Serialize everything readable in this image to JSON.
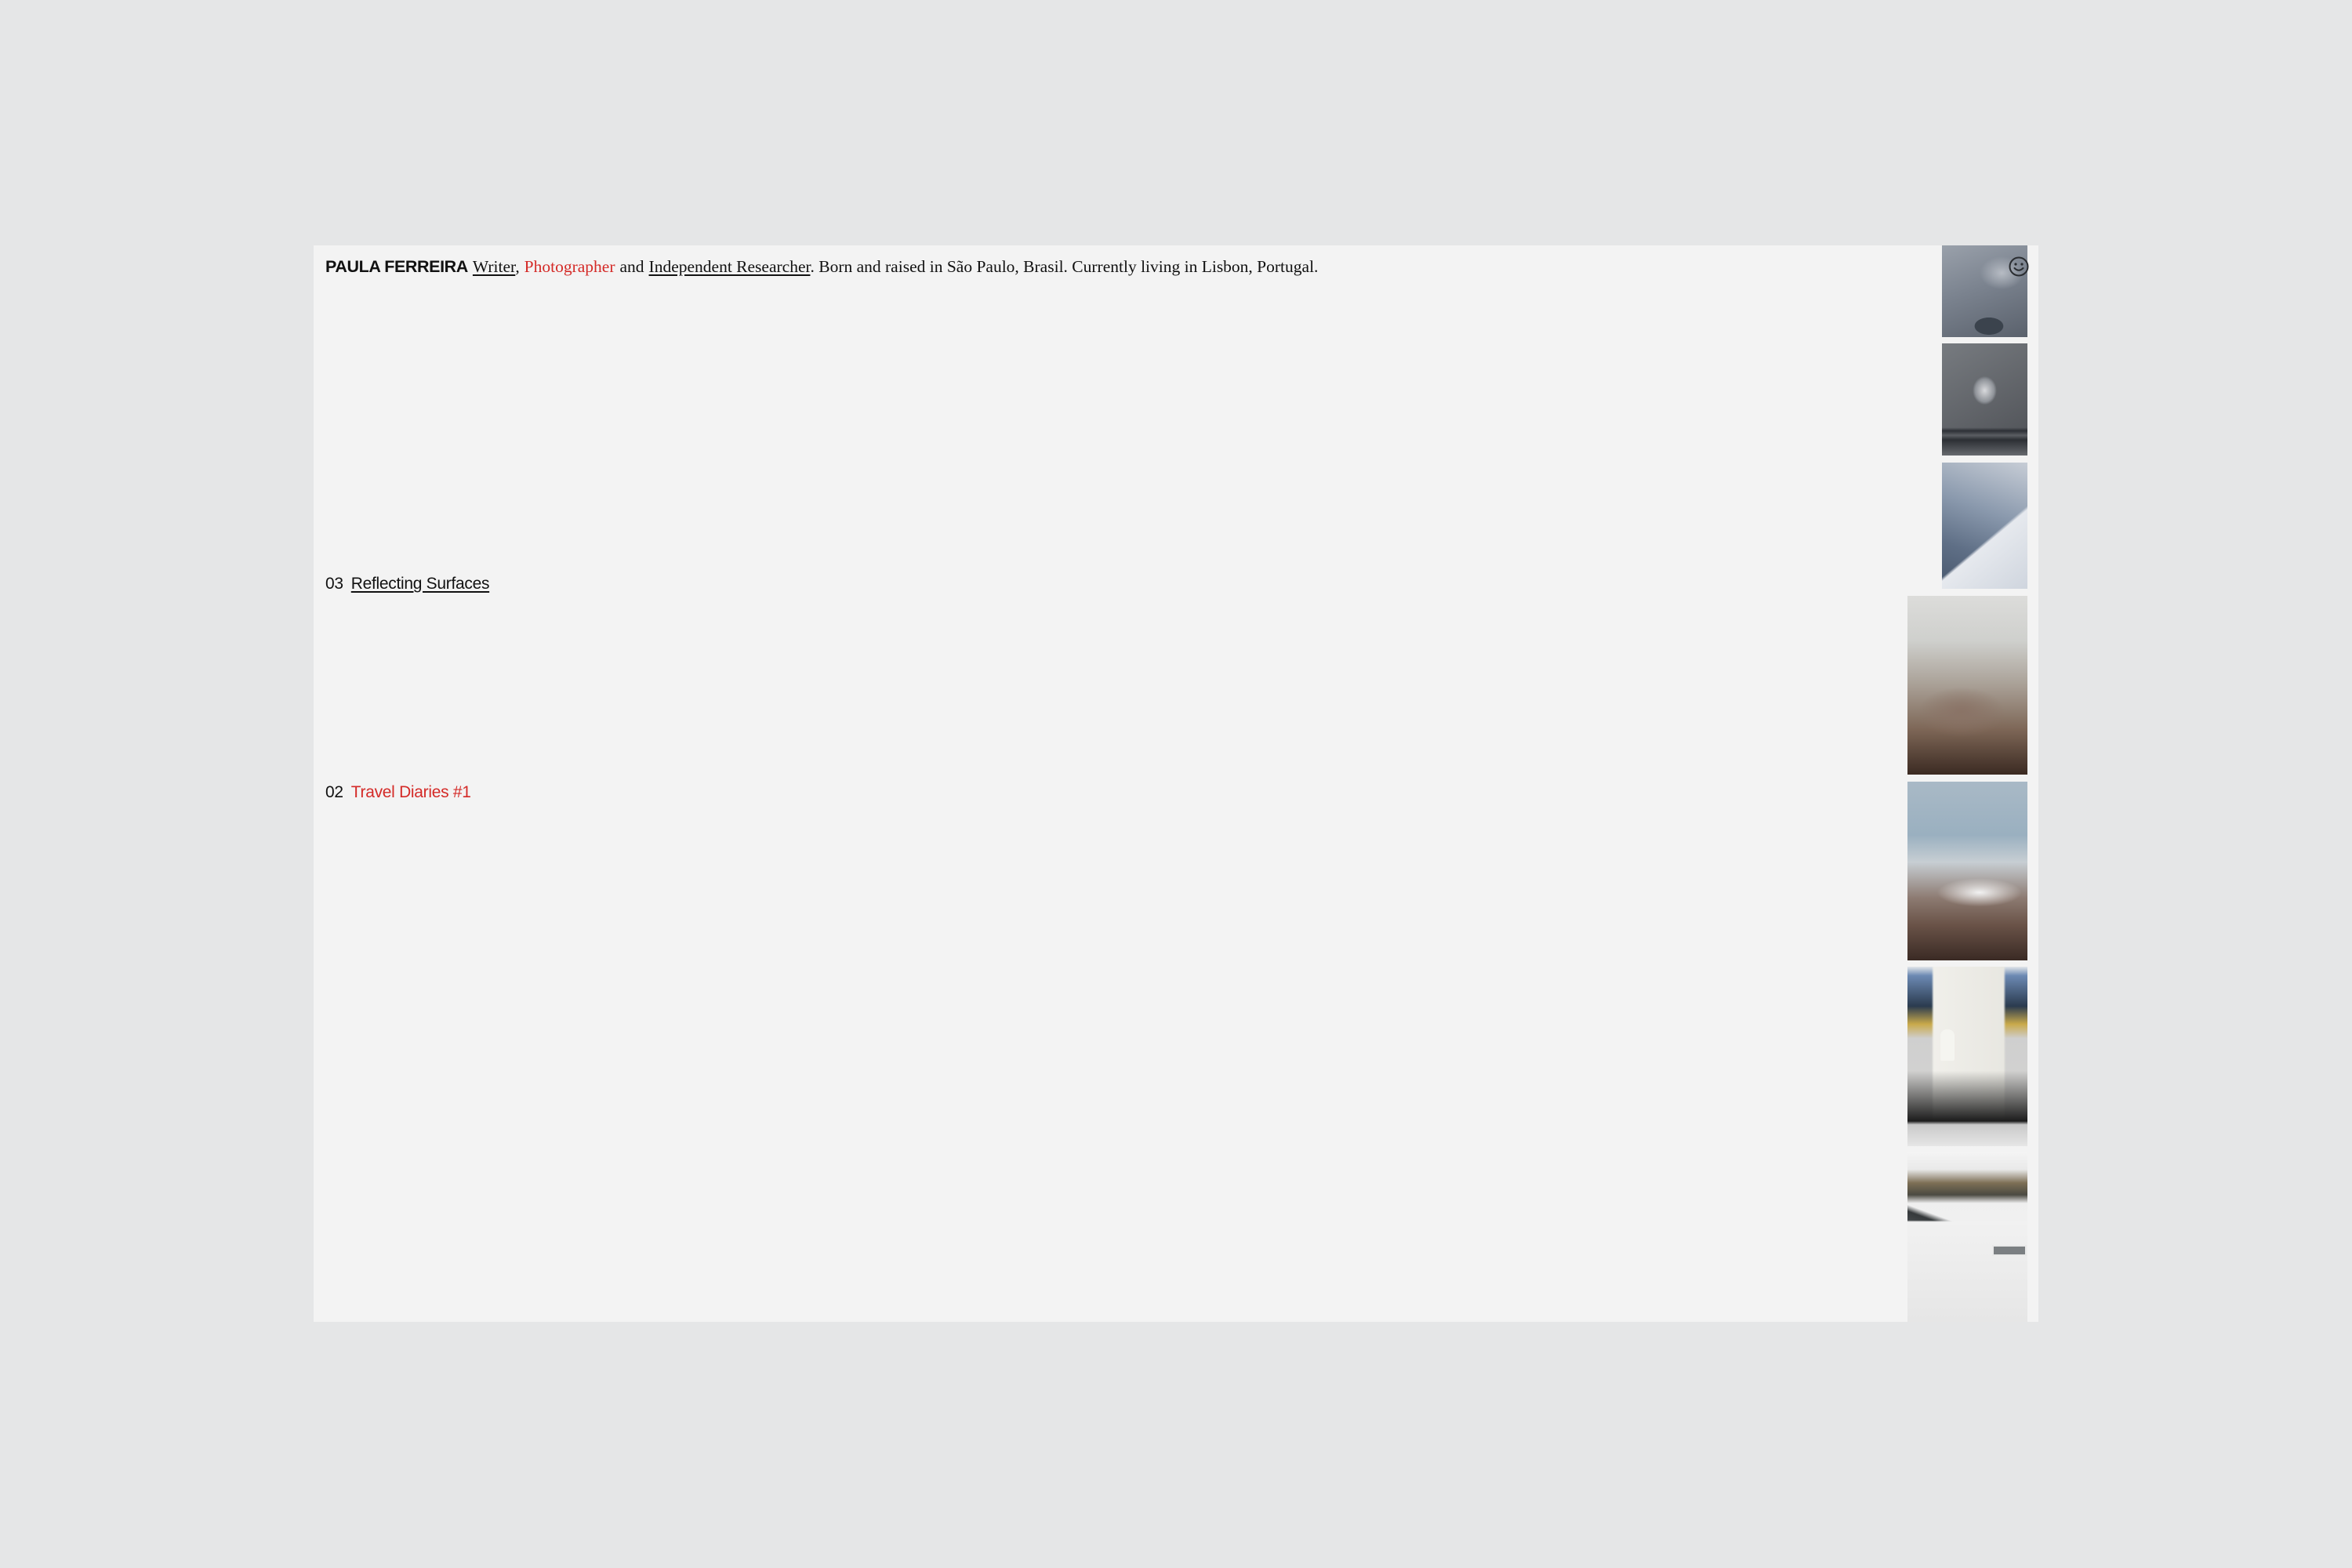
{
  "header": {
    "name": "PAULA FERREIRA",
    "role_writer": "Writer",
    "comma": ",",
    "role_photographer": "Photographer",
    "and": "and",
    "role_researcher": "Independent Researcher",
    "bio": ". Born and raised in São Paulo, Brasil. Currently living in Lisbon, Portugal."
  },
  "projects": [
    {
      "number": "03",
      "title": "Reflecting Surfaces",
      "active": false
    },
    {
      "number": "02",
      "title": "Travel Diaries #1",
      "active": true
    }
  ],
  "icons": {
    "corner": "smiley-icon"
  },
  "colors": {
    "accent": "#d42a27",
    "background": "#e5e6e7",
    "panel": "#f3f3f3",
    "text": "#111111"
  }
}
